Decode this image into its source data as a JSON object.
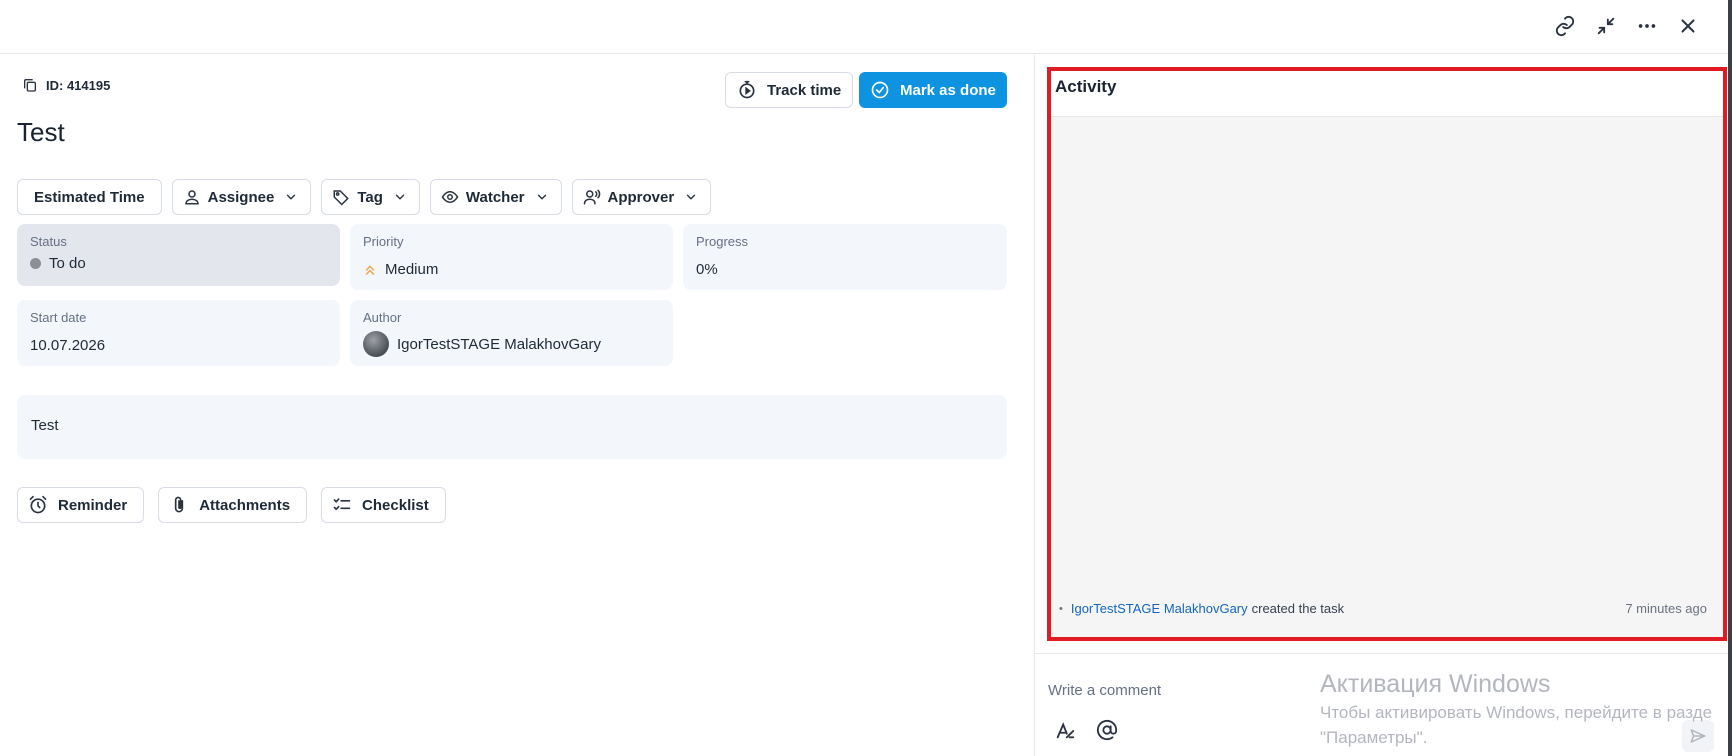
{
  "top_actions": {
    "link_icon": "link-icon",
    "collapse_icon": "collapse-icon",
    "more_icon": "more-icon",
    "close_icon": "close-icon"
  },
  "task": {
    "id_label": "ID: 414195",
    "title": "Test",
    "track_time_label": "Track time",
    "mark_done_label": "Mark as done",
    "description": "Test"
  },
  "fields_toolbar": {
    "estimated_time": "Estimated Time",
    "assignee": "Assignee",
    "tag": "Tag",
    "watcher": "Watcher",
    "approver": "Approver"
  },
  "details": {
    "status": {
      "label": "Status",
      "value": "To do"
    },
    "priority": {
      "label": "Priority",
      "value": "Medium"
    },
    "progress": {
      "label": "Progress",
      "value": "0%"
    },
    "start_date": {
      "label": "Start date",
      "value": "10.07.2026"
    },
    "author": {
      "label": "Author",
      "value": "IgorTestSTAGE MalakhovGary"
    }
  },
  "attachments_toolbar": {
    "reminder": "Reminder",
    "attachments": "Attachments",
    "checklist": "Checklist"
  },
  "activity": {
    "title": "Activity",
    "entries": [
      {
        "user": "IgorTestSTAGE MalakhovGary",
        "action": "created the task",
        "time": "7 minutes ago"
      }
    ]
  },
  "comment": {
    "placeholder": "Write a comment"
  },
  "windows_watermark": {
    "title": "Активация Windows",
    "line1": "Чтобы активировать Windows, перейдите в разде",
    "line2": "\"Параметры\"."
  },
  "colors": {
    "primary": "#0d93df",
    "highlight_border": "#e01b24",
    "link": "#1565c0",
    "card_bg": "#f3f6fb",
    "priority_accent": "#f0a24b"
  }
}
